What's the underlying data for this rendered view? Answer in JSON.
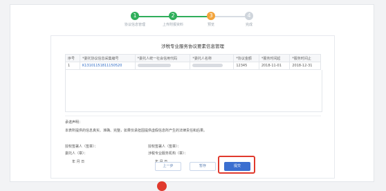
{
  "steps": [
    {
      "label": "协议信息管理",
      "number": "1",
      "state": "done"
    },
    {
      "label": "上传附报资料",
      "number": "2",
      "state": "done"
    },
    {
      "label": "预览",
      "number": "3",
      "state": "current"
    },
    {
      "label": "完成",
      "number": "4",
      "state": "pending"
    }
  ],
  "card": {
    "title": "涉税专业服务协议要素信息管理",
    "table": {
      "headers": [
        "序号",
        "*委托协议信息采集编号",
        "*委托人统一社会信用代码",
        "*委托人名称",
        "*协议金额",
        "*服务时间起",
        "*服务时间止"
      ],
      "rows": [
        {
          "index": "1",
          "agreement_no": "K13101151811150520",
          "credit_code": "",
          "client_name": "",
          "amount": "12345",
          "start": "2018-11-01",
          "end": "2018-12-31"
        }
      ]
    },
    "declaration_title": "承诺声明：",
    "declaration_text": "本表所提供的信息真实、准确、完整，如果仅承担因提供虚假信息所产生的法律责任和后果。",
    "signatures": {
      "left_1": "授权签署人（签章）：",
      "left_2": "委托人（章）：",
      "left_date": "年   月   日",
      "right_1": "授权签署人（签章）：",
      "right_2": "涉税专业服务机构（章）：",
      "right_date": "年   月   日"
    },
    "buttons": {
      "prev": "上一步",
      "save": "暂存",
      "submit": "提交"
    }
  },
  "colors": {
    "done": "#2fae5a",
    "current": "#f3a43b",
    "pending": "#cfd5dc",
    "primary": "#3b6fd0",
    "highlight": "#e0392d"
  }
}
